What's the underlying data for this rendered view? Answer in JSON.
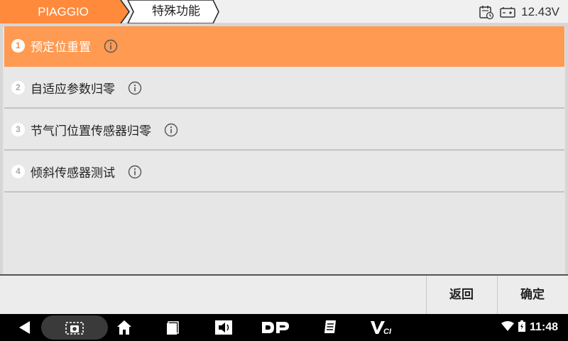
{
  "header": {
    "brand": "PIAGGIO",
    "section": "特殊功能",
    "voltage": "12.43V",
    "brand_color": "#ff8a3c"
  },
  "menu": {
    "items": [
      {
        "num": "1",
        "label": "预定位重置",
        "selected": true
      },
      {
        "num": "2",
        "label": "自适应参数归零",
        "selected": false
      },
      {
        "num": "3",
        "label": "节气门位置传感器归零",
        "selected": false
      },
      {
        "num": "4",
        "label": "倾斜传感器测试",
        "selected": false
      }
    ]
  },
  "actions": {
    "back_label": "返回",
    "confirm_label": "确定"
  },
  "navbar": {
    "time": "11:48",
    "icons": [
      "back-icon",
      "screenshot-icon",
      "home-icon",
      "recent-apps-icon",
      "volume-icon",
      "dp-icon",
      "report-icon",
      "vci-icon",
      "wifi-icon",
      "battery-icon"
    ]
  }
}
